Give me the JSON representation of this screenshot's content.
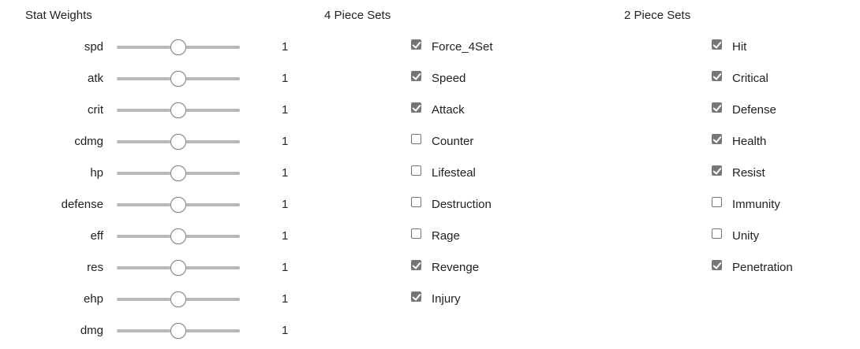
{
  "stat_weights": {
    "title": "Stat Weights",
    "items": [
      {
        "label": "spd",
        "value": "1",
        "slider_fraction": 0.5
      },
      {
        "label": "atk",
        "value": "1",
        "slider_fraction": 0.5
      },
      {
        "label": "crit",
        "value": "1",
        "slider_fraction": 0.5
      },
      {
        "label": "cdmg",
        "value": "1",
        "slider_fraction": 0.5
      },
      {
        "label": "hp",
        "value": "1",
        "slider_fraction": 0.5
      },
      {
        "label": "defense",
        "value": "1",
        "slider_fraction": 0.5
      },
      {
        "label": "eff",
        "value": "1",
        "slider_fraction": 0.5
      },
      {
        "label": "res",
        "value": "1",
        "slider_fraction": 0.5
      },
      {
        "label": "ehp",
        "value": "1",
        "slider_fraction": 0.5
      },
      {
        "label": "dmg",
        "value": "1",
        "slider_fraction": 0.5
      }
    ]
  },
  "four_piece_sets": {
    "title": "4 Piece Sets",
    "items": [
      {
        "label": "Force_4Set",
        "checked": true
      },
      {
        "label": "Speed",
        "checked": true
      },
      {
        "label": "Attack",
        "checked": true
      },
      {
        "label": "Counter",
        "checked": false
      },
      {
        "label": "Lifesteal",
        "checked": false
      },
      {
        "label": "Destruction",
        "checked": false
      },
      {
        "label": "Rage",
        "checked": false
      },
      {
        "label": "Revenge",
        "checked": true
      },
      {
        "label": "Injury",
        "checked": true
      }
    ]
  },
  "two_piece_sets": {
    "title": "2 Piece Sets",
    "items": [
      {
        "label": "Hit",
        "checked": true
      },
      {
        "label": "Critical",
        "checked": true
      },
      {
        "label": "Defense",
        "checked": true
      },
      {
        "label": "Health",
        "checked": true
      },
      {
        "label": "Resist",
        "checked": true
      },
      {
        "label": "Immunity",
        "checked": false
      },
      {
        "label": "Unity",
        "checked": false
      },
      {
        "label": "Penetration",
        "checked": true
      }
    ]
  },
  "colors": {
    "checkbox_checked": "#767676",
    "slider_track": "#b8b8b8",
    "text": "#222222"
  }
}
